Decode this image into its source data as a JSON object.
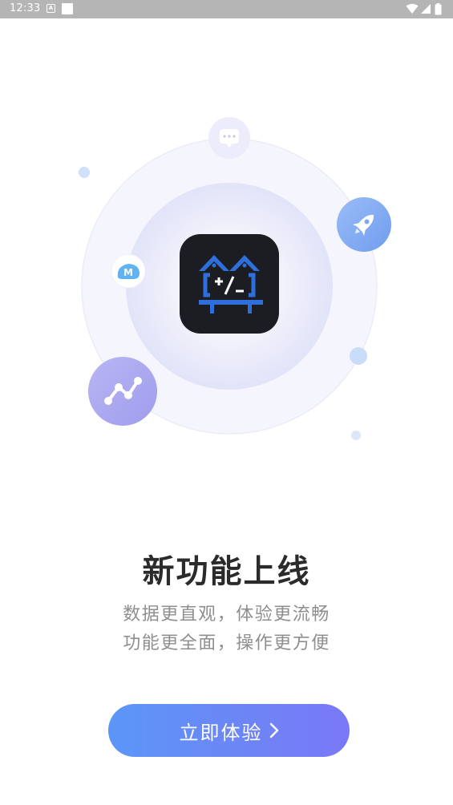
{
  "status_bar": {
    "time": "12:33",
    "icons": [
      "a-notification-icon",
      "square-notification-icon",
      "wifi-icon",
      "signal-icon",
      "battery-icon"
    ]
  },
  "illustration": {
    "app_icon_name": "calculator-house-icon",
    "floating_icons": [
      "chat-bubble-icon",
      "rocket-icon",
      "m-logo-icon",
      "trend-line-icon"
    ],
    "colors": {
      "outer_ring": "#f3f3fc",
      "inner_circle": "#e7e8fa",
      "app_tile": "#1c1d22",
      "app_blue": "#2f6fdc",
      "rocket_circle": "#7fa9f3",
      "trend_circle": "#a7a5ef"
    }
  },
  "title": "新功能上线",
  "subtitle": {
    "line1": "数据更直观，体验更流畅",
    "line2": "功能更全面，操作更方便"
  },
  "cta": {
    "label": "立即体验",
    "gradient_start": "#5b96f7",
    "gradient_end": "#7a78f6"
  }
}
